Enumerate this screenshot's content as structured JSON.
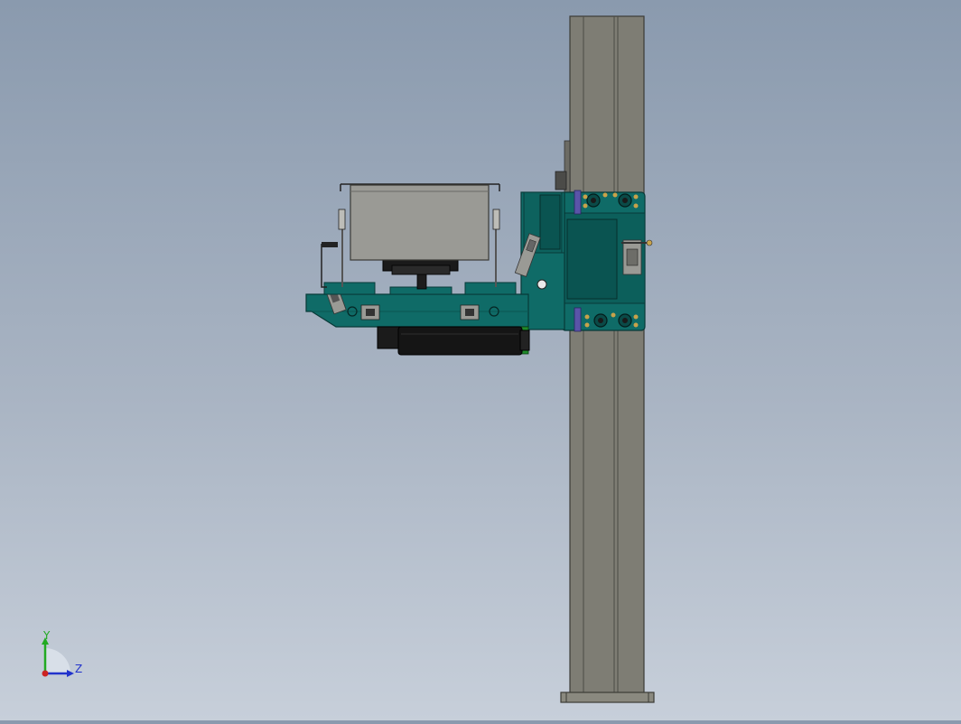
{
  "viewport": {
    "background_top": "#8a9aae",
    "background_bottom": "#c7cfda"
  },
  "model_colors": {
    "carriage": "#0f6b67",
    "carriage_dark": "#0a4a47",
    "column": "#7e7d74",
    "column_edge": "#3b3b36",
    "hopper": "#9a9a95",
    "motor": "#151515",
    "roller_accent": "#5a54a8",
    "bolt": "#c8a24a"
  },
  "triad": {
    "y_label": "Y",
    "z_label": "Z",
    "y_color": "#22aa22",
    "z_color": "#2233cc",
    "origin_color": "#cc2222"
  }
}
